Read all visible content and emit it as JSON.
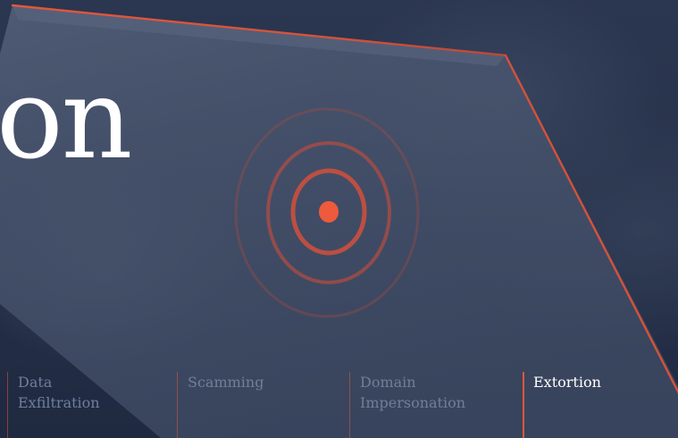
{
  "hero": {
    "title_fragment": "on"
  },
  "nav": {
    "items": [
      {
        "line1": "Data",
        "line2": "Exfiltration",
        "active": false
      },
      {
        "line1": "Scamming",
        "line2": "",
        "active": false
      },
      {
        "line1": "Domain",
        "line2": "Impersonation",
        "active": false
      },
      {
        "line1": "Extortion",
        "line2": "",
        "active": true
      }
    ]
  },
  "colors": {
    "background": "#1f2940",
    "accent": "#e4573a",
    "inactive_text": "#6f7f99",
    "active_text": "#ffffff",
    "laptop_screen": "#47536d"
  },
  "icons": {
    "target": "radar-target-icon"
  }
}
